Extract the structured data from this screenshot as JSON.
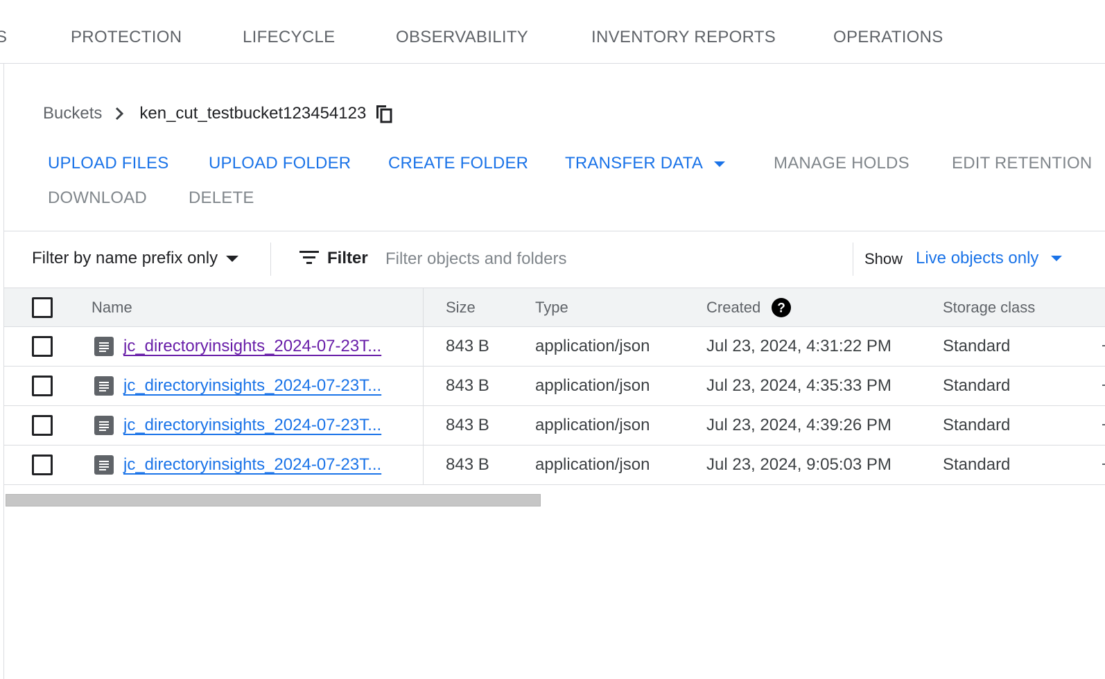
{
  "tabs": {
    "partial": "S",
    "protection": "PROTECTION",
    "lifecycle": "LIFECYCLE",
    "observability": "OBSERVABILITY",
    "inventory_reports": "INVENTORY REPORTS",
    "operations": "OPERATIONS"
  },
  "breadcrumb": {
    "parent": "Buckets",
    "current": "ken_cut_testbucket123454123"
  },
  "actions": {
    "upload_files": "UPLOAD FILES",
    "upload_folder": "UPLOAD FOLDER",
    "create_folder": "CREATE FOLDER",
    "transfer_data": "TRANSFER DATA",
    "manage_holds": "MANAGE HOLDS",
    "edit_retention": "EDIT RETENTION",
    "download": "DOWNLOAD",
    "delete": "DELETE"
  },
  "filterbar": {
    "prefix_mode": "Filter by name prefix only",
    "filter_label": "Filter",
    "filter_placeholder": "Filter objects and folders",
    "show_label": "Show",
    "show_value": "Live objects only"
  },
  "table": {
    "headers": {
      "name": "Name",
      "size": "Size",
      "type": "Type",
      "created": "Created",
      "storage_class": "Storage class"
    },
    "rows": [
      {
        "name": "jc_directoryinsights_2024-07-23T...",
        "size": "843 B",
        "type": "application/json",
        "created": "Jul 23, 2024, 4:31:22 PM",
        "storage_class": "Standard"
      },
      {
        "name": "jc_directoryinsights_2024-07-23T...",
        "size": "843 B",
        "type": "application/json",
        "created": "Jul 23, 2024, 4:35:33 PM",
        "storage_class": "Standard"
      },
      {
        "name": "jc_directoryinsights_2024-07-23T...",
        "size": "843 B",
        "type": "application/json",
        "created": "Jul 23, 2024, 4:39:26 PM",
        "storage_class": "Standard"
      },
      {
        "name": "jc_directoryinsights_2024-07-23T...",
        "size": "843 B",
        "type": "application/json",
        "created": "Jul 23, 2024, 9:05:03 PM",
        "storage_class": "Standard"
      }
    ]
  },
  "colors": {
    "accent": "#1a73e8",
    "visited_link": "#681da8",
    "muted": "#80868b"
  }
}
